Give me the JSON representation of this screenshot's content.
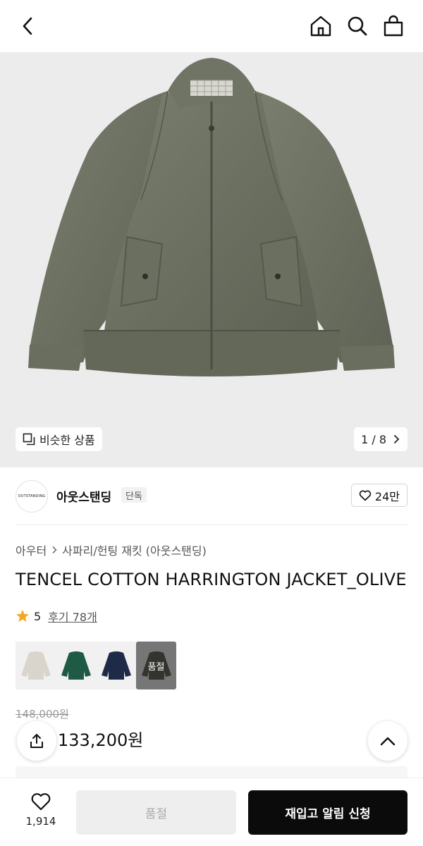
{
  "header": {
    "back_icon": "chevron-left-icon",
    "home_icon": "home-icon",
    "search_icon": "search-icon",
    "cart_icon": "shopping-bag-icon"
  },
  "gallery": {
    "similar_label": "비슷한 상품",
    "counter": "1 / 8",
    "image_alt": "olive harrington jacket"
  },
  "brand": {
    "logo_text": "OUTSTANDING",
    "name": "아웃스탠딩",
    "tag": "단독",
    "likes": "24만"
  },
  "product": {
    "breadcrumb": [
      "아우터",
      "사파리/헌팅 재킷 (아웃스탠딩)"
    ],
    "title": "TENCEL COTTON HARRINGTON JACKET_OLIVE",
    "rating": "5",
    "reviews": "후기 78개",
    "swatches": [
      {
        "color": "#d9d5cc",
        "sold_out": false
      },
      {
        "color": "#1f5a44",
        "sold_out": false
      },
      {
        "color": "#1e2a48",
        "sold_out": false
      },
      {
        "color": "#5b5f52",
        "sold_out": true,
        "label": "품절"
      }
    ],
    "original_price": "148,000원",
    "price": "133,200원"
  },
  "bottom_bar": {
    "wish_count": "1,914",
    "soldout_label": "품절",
    "restock_label": "재입고 알림 신청"
  },
  "colors": {
    "accent_star": "#f5a623",
    "olive": "#6f7364",
    "cta_black": "#0b0b0b"
  }
}
